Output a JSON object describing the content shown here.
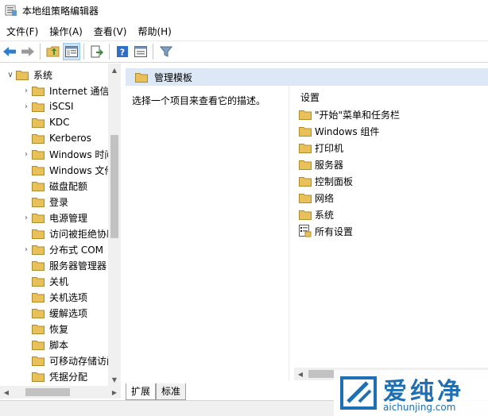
{
  "window": {
    "title": "本地组策略编辑器"
  },
  "menu": [
    "文件(F)",
    "操作(A)",
    "查看(V)",
    "帮助(H)"
  ],
  "toolbar_icons": [
    "back-arrow-icon",
    "forward-arrow-icon",
    "up-folder-icon",
    "show-hide-tree-icon",
    "export-list-icon",
    "help-icon",
    "properties-icon",
    "filter-icon"
  ],
  "tree": {
    "root": "系统",
    "items": [
      {
        "label": "Internet 通信",
        "expandable": true
      },
      {
        "label": "iSCSI",
        "expandable": true
      },
      {
        "label": "KDC",
        "expandable": false
      },
      {
        "label": "Kerberos",
        "expandable": false
      },
      {
        "label": "Windows 时间",
        "expandable": true
      },
      {
        "label": "Windows 文件",
        "expandable": false
      },
      {
        "label": "磁盘配额",
        "expandable": false
      },
      {
        "label": "登录",
        "expandable": false
      },
      {
        "label": "电源管理",
        "expandable": true
      },
      {
        "label": "访问被拒绝协助",
        "expandable": false
      },
      {
        "label": "分布式 COM",
        "expandable": true
      },
      {
        "label": "服务器管理器",
        "expandable": false
      },
      {
        "label": "关机",
        "expandable": false
      },
      {
        "label": "关机选项",
        "expandable": false
      },
      {
        "label": "缓解选项",
        "expandable": false
      },
      {
        "label": "恢复",
        "expandable": false
      },
      {
        "label": "脚本",
        "expandable": false
      },
      {
        "label": "可移动存储访问",
        "expandable": false
      },
      {
        "label": "凭据分配",
        "expandable": false
      }
    ]
  },
  "right": {
    "header": "管理模板",
    "description": "选择一个项目来查看它的描述。",
    "column_header": "设置",
    "items": [
      {
        "label": "\"开始\"菜单和任务栏",
        "icon": "folder-icon"
      },
      {
        "label": "Windows 组件",
        "icon": "folder-icon"
      },
      {
        "label": "打印机",
        "icon": "folder-icon"
      },
      {
        "label": "服务器",
        "icon": "folder-icon"
      },
      {
        "label": "控制面板",
        "icon": "folder-icon"
      },
      {
        "label": "网络",
        "icon": "folder-icon"
      },
      {
        "label": "系统",
        "icon": "folder-icon"
      },
      {
        "label": "所有设置",
        "icon": "all-settings-icon"
      }
    ]
  },
  "tabs": [
    "扩展",
    "标准"
  ],
  "watermark": {
    "brand": "爱纯净",
    "url": "aichunjing.com"
  },
  "colors": {
    "header_bg": "#dde8f6",
    "folder": "#e8c15a",
    "watermark": "#1f6fb5"
  }
}
